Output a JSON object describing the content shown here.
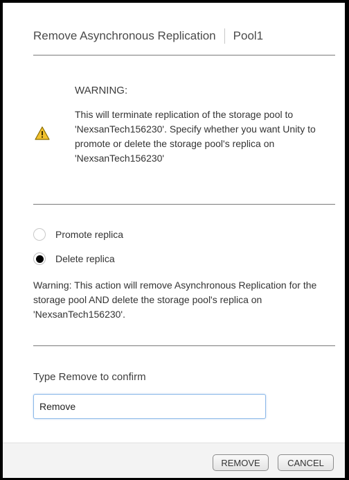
{
  "dialog": {
    "title": "Remove Asynchronous Replication",
    "subtitle": "Pool1"
  },
  "warning": {
    "icon": "warning-triangle-icon",
    "heading": "WARNING:",
    "text": "This will terminate replication of the storage pool to 'NexsanTech156230'. Specify whether you want Unity to promote or delete the storage pool's replica on 'NexsanTech156230'"
  },
  "options": {
    "promote_label": "Promote replica",
    "delete_label": "Delete replica",
    "selected": "Delete replica"
  },
  "note": "Warning: This action will remove Asynchronous Replication for the storage pool AND delete the storage pool's replica on 'NexsanTech156230'.",
  "confirm": {
    "label": "Type Remove to confirm",
    "value": "Remove"
  },
  "buttons": {
    "remove": "REMOVE",
    "cancel": "CANCEL"
  },
  "colors": {
    "warning_icon_fill": "#f2c12e",
    "input_focus_border": "#8bb8e8"
  }
}
